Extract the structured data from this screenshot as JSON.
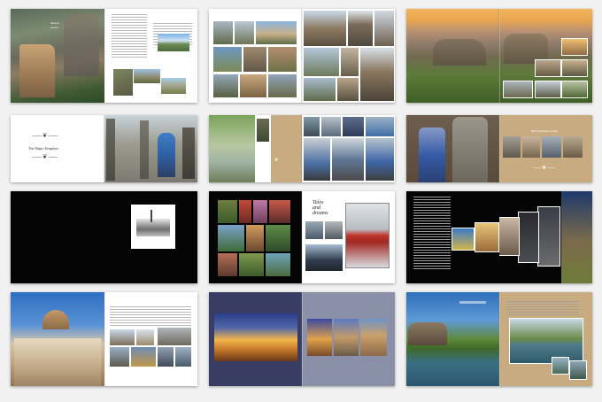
{
  "gallery": {
    "spreads": [
      {
        "name": "meteora-monastery",
        "text": {
          "title": "Meteora",
          "caption": "Greece"
        }
      },
      {
        "name": "meteora-collage"
      },
      {
        "name": "meteora-panorama"
      },
      {
        "name": "magic-kingdom",
        "text": {
          "title": "The Magic Kingdom"
        }
      },
      {
        "name": "theme-park"
      },
      {
        "name": "enchanted-garden",
        "text": {
          "title": "Bali's Enchanted Garden"
        }
      },
      {
        "name": "black-city"
      },
      {
        "name": "tales-dreams",
        "text": {
          "script": "Tales\nand\ndreams"
        }
      },
      {
        "name": "night-travel"
      },
      {
        "name": "mysore-palace"
      },
      {
        "name": "palace-night"
      },
      {
        "name": "kerala-backwaters"
      }
    ]
  },
  "colors": {
    "background": "#f1f1f1",
    "black_page": "#050505",
    "tan_page": "#c9ab82",
    "navy_page": "#3a3d63",
    "slate_page": "#8a90a8"
  },
  "icons": [
    "flourish-icon"
  ]
}
